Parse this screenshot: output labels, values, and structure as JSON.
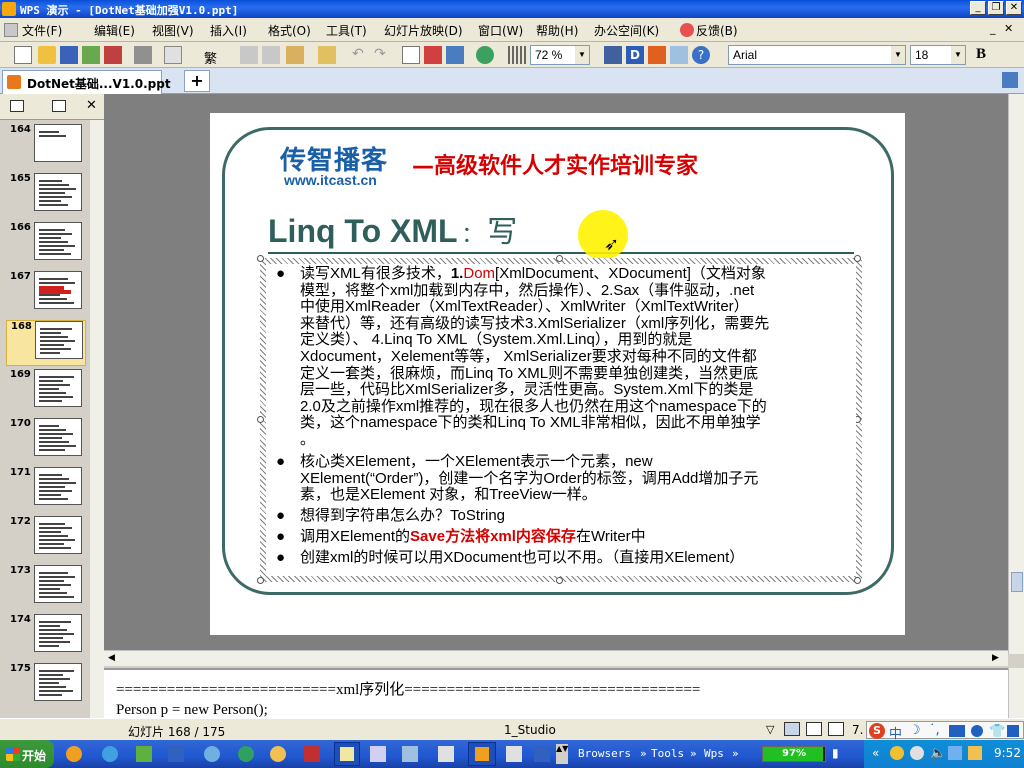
{
  "window": {
    "title": "WPS 演示 - [DotNet基础加强V1.0.ppt]"
  },
  "menu": [
    "文件(F)",
    "编辑(E)",
    "视图(V)",
    "插入(I)",
    "格式(O)",
    "工具(T)",
    "幻灯片放映(D)",
    "窗口(W)",
    "帮助(H)",
    "办公空间(K)",
    "反馈(B)"
  ],
  "toolbar": {
    "zoom": "72 %",
    "font": "Arial",
    "font_size": "18",
    "bold": "B",
    "trad": "繁"
  },
  "tab": {
    "label": "DotNet基础...V1.0.ppt",
    "add": "+"
  },
  "thumbnails": [
    "164",
    "165",
    "166",
    "167",
    "168",
    "169",
    "170",
    "171",
    "172",
    "173",
    "174",
    "175"
  ],
  "slide": {
    "logo_cn": "传智播客",
    "logo_url": "www.itcast.cn",
    "slogan": "—高级软件人才实作培训专家",
    "title": "Linq To XML",
    "title_sep": "：",
    "title_cn": "写",
    "bullet": "●",
    "b1": {
      "l1a": "读写XML有很多技术，",
      "l1b": "1.",
      "l1c": "Dom",
      "l1d": "[XmlDocument、XDocument]（文档对象",
      "l2": "模型，将整个xml加载到内存中，然后操作）、2.Sax（事件驱动，.net",
      "l3": "中使用XmlReader（XmlTextReader）、XmlWriter（XmlTextWriter）",
      "l4": "来替代）等，还有高级的读写技术3.XmlSerializer（xml序列化，需要先",
      "l5": "定义类）、 4.Linq To XML（System.Xml.Linq），用到的就是",
      "l6": "Xdocument，Xelement等等， XmlSerializer要求对每种不同的文件都",
      "l7": "定义一套类，很麻烦，而Linq To XML则不需要单独创建类，当然更底",
      "l8": "层一些，代码比XmlSerializer多，灵活性更高。System.Xml下的类是",
      "l9": "2.0及之前操作xml推荐的，现在很多人也仍然在用这个namespace下的",
      "l10": "类，这个namespace下的类和Linq To XML非常相似，因此不用单独学",
      "l11": "。"
    },
    "b2": {
      "l1": "核心类XElement，一个XElement表示一个元素，new",
      "l2": "XElement(“Order”)，创建一个名字为Order的标签，调用Add增加子元",
      "l3": "素，也是XElement 对象，和TreeView一样。"
    },
    "b3": "想得到字符串怎么办？ToString",
    "b4": {
      "a": "调用XElement的",
      "b": "Save方法将xml内容保存",
      "c": "在Writer中"
    },
    "b5": "创建xml的时候可以用XDocument也可以不用。（直接用XElement）"
  },
  "notes": {
    "line1": "==========================xml序列化===================================",
    "line2": "Person p = new Person();"
  },
  "status": {
    "slide": "幻灯片 168 / 175",
    "template": "1_Studio",
    "zoom_short": "7."
  },
  "taskbar": {
    "start": "开始",
    "browsers": "Browsers",
    "tools": "Tools",
    "wps": "Wps",
    "battery": "97%",
    "clock": "9:52"
  },
  "colors": {
    "title_teal": "#2f5f5a",
    "accent_red": "#d60000",
    "logo_blue": "#1a5fa8"
  }
}
